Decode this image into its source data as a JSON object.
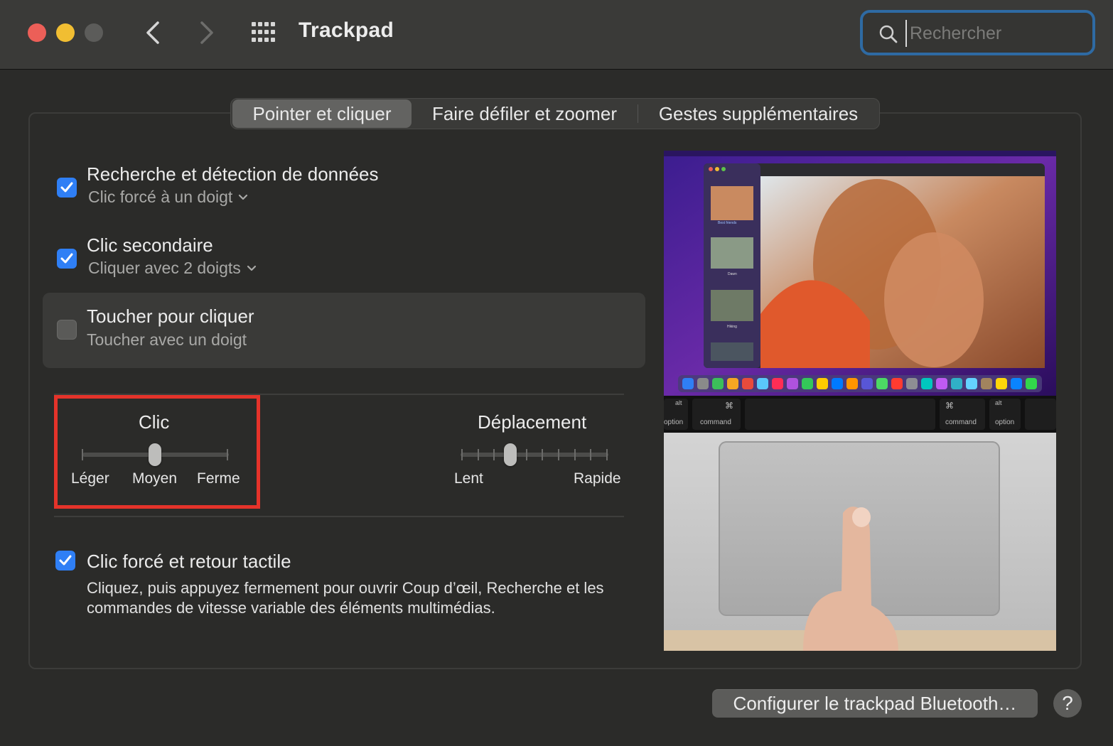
{
  "window": {
    "title": "Trackpad",
    "search_placeholder": "Rechercher"
  },
  "tabs": [
    {
      "label": "Pointer et cliquer",
      "selected": true
    },
    {
      "label": "Faire défiler et zoomer",
      "selected": false
    },
    {
      "label": "Gestes supplémentaires",
      "selected": false
    }
  ],
  "options": [
    {
      "title": "Recherche et détection de données",
      "subtitle": "Clic forcé à un doigt",
      "checked": true
    },
    {
      "title": "Clic secondaire",
      "subtitle": "Cliquer avec 2 doigts",
      "checked": true
    },
    {
      "title": "Toucher pour cliquer",
      "subtitle": "Toucher avec un doigt",
      "checked": false
    }
  ],
  "sliders": {
    "click": {
      "title": "Clic",
      "labels": [
        "Léger",
        "Moyen",
        "Ferme"
      ],
      "value_index": 1,
      "steps": 3
    },
    "tracking": {
      "title": "Déplacement",
      "min_label": "Lent",
      "max_label": "Rapide",
      "value_index": 3,
      "steps": 10
    }
  },
  "force_click": {
    "title": "Clic forcé et retour tactile",
    "checked": true,
    "description": "Cliquez, puis appuyez fermement pour ouvrir Coup d’œil, Recherche et les commandes de vitesse variable des éléments multimédias."
  },
  "preview": {
    "keys": {
      "left_alt": "alt",
      "left_option": "option",
      "left_command": "command",
      "right_command": "command",
      "right_alt": "alt",
      "right_option": "option",
      "command_symbol": "⌘"
    },
    "thumbnails": [
      "Best friends",
      "Dawn",
      "Hiking"
    ]
  },
  "buttons": {
    "configure": "Configurer le trackpad Bluetooth…",
    "help": "?"
  },
  "colors": {
    "accent": "#2f7ff5",
    "highlight_box": "#e5332a",
    "search_focus": "#2e6aa3"
  }
}
